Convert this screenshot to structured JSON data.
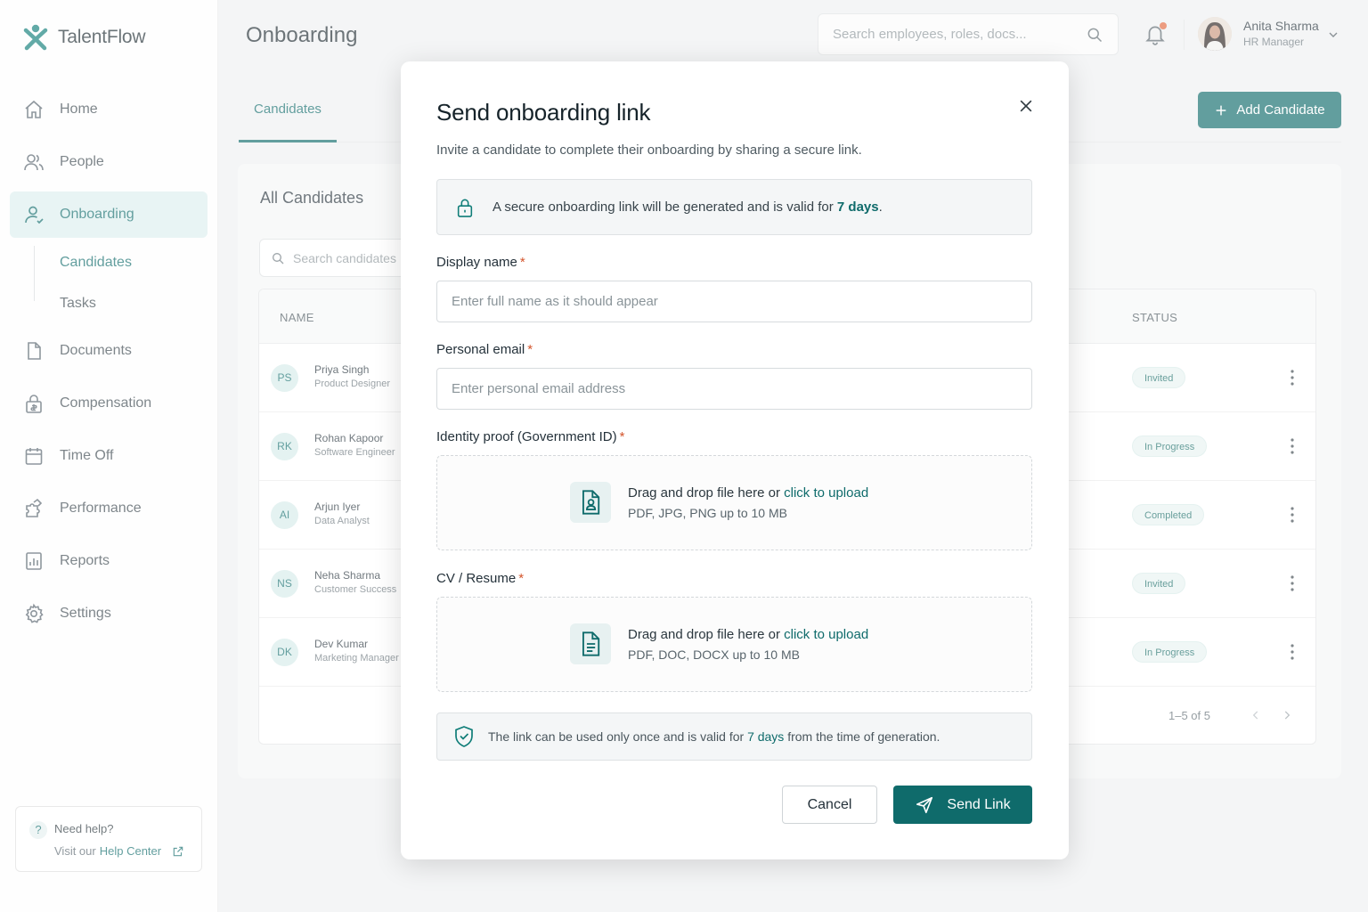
{
  "app": {
    "name": "TalentFlow",
    "brand_color": "#0f6b6b"
  },
  "sidebar": {
    "items": [
      {
        "label": "Home",
        "icon": "home-icon"
      },
      {
        "label": "People",
        "icon": "users-icon"
      },
      {
        "label": "Onboarding",
        "icon": "user-icon",
        "active": true
      },
      {
        "label": "Documents",
        "icon": "document-icon"
      },
      {
        "label": "Compensation",
        "icon": "lock-money-icon"
      },
      {
        "label": "Time Off",
        "icon": "calendar-icon"
      },
      {
        "label": "Performance",
        "icon": "puzzle-icon"
      },
      {
        "label": "Reports",
        "icon": "chart-icon"
      },
      {
        "label": "Settings",
        "icon": "gear-icon"
      }
    ],
    "subitems": [
      {
        "label": "Candidates",
        "active": true
      },
      {
        "label": "Tasks"
      }
    ],
    "help": {
      "title": "Need help?",
      "prefix": "Visit our",
      "link": "Help Center"
    }
  },
  "header": {
    "title": "Onboarding",
    "search_placeholder": "Search employees, roles, docs...",
    "user": {
      "name": "Anita Sharma",
      "role": "HR Manager"
    }
  },
  "tabs": [
    {
      "label": "Candidates",
      "active": true
    }
  ],
  "add_candidate_label": "Add Candidate",
  "candidates": {
    "title": "All Candidates",
    "search_placeholder": "Search candidates",
    "columns": {
      "name": "NAME",
      "status": "STATUS"
    },
    "rows": [
      {
        "initials": "PS",
        "name": "Priya Singh",
        "role": "Product Designer",
        "status": "Invited"
      },
      {
        "initials": "RK",
        "name": "Rohan Kapoor",
        "role": "Software Engineer",
        "status": "In Progress"
      },
      {
        "initials": "AI",
        "name": "Arjun Iyer",
        "role": "Data Analyst",
        "status": "Completed"
      },
      {
        "initials": "NS",
        "name": "Neha Sharma",
        "role": "Customer Success",
        "status": "Invited"
      },
      {
        "initials": "DK",
        "name": "Dev Kumar",
        "role": "Marketing Manager",
        "status": "In Progress"
      }
    ],
    "pagination": "1–5 of 5"
  },
  "modal": {
    "title": "Send onboarding link",
    "subtitle": "Invite a candidate to complete their onboarding by sharing a secure link.",
    "info": {
      "text": "A secure onboarding link will be generated and is valid for",
      "highlight": "7 days",
      "end": "."
    },
    "fields": {
      "display_name": {
        "label": "Display name",
        "required_mark": "*",
        "placeholder": "Enter full name as it should appear"
      },
      "email": {
        "label": "Personal email",
        "required_mark": "*",
        "placeholder": "Enter personal email address"
      },
      "id_proof": {
        "label": "Identity proof (Government ID)",
        "required_mark": "*",
        "drop_text": "Drag and drop file here or",
        "link": "click to upload",
        "hint": "PDF, JPG, PNG up to 10 MB"
      },
      "cv": {
        "label": "CV / Resume",
        "required_mark": "*",
        "drop_text": "Drag and drop file here or",
        "link": "click to upload",
        "hint": "PDF, DOC, DOCX up to 10 MB"
      }
    },
    "note": {
      "prefix": "The link can be used only once and is valid for",
      "highlight": "7 days",
      "suffix": "from the time of generation."
    },
    "cancel_label": "Cancel",
    "send_label": "Send Link"
  }
}
